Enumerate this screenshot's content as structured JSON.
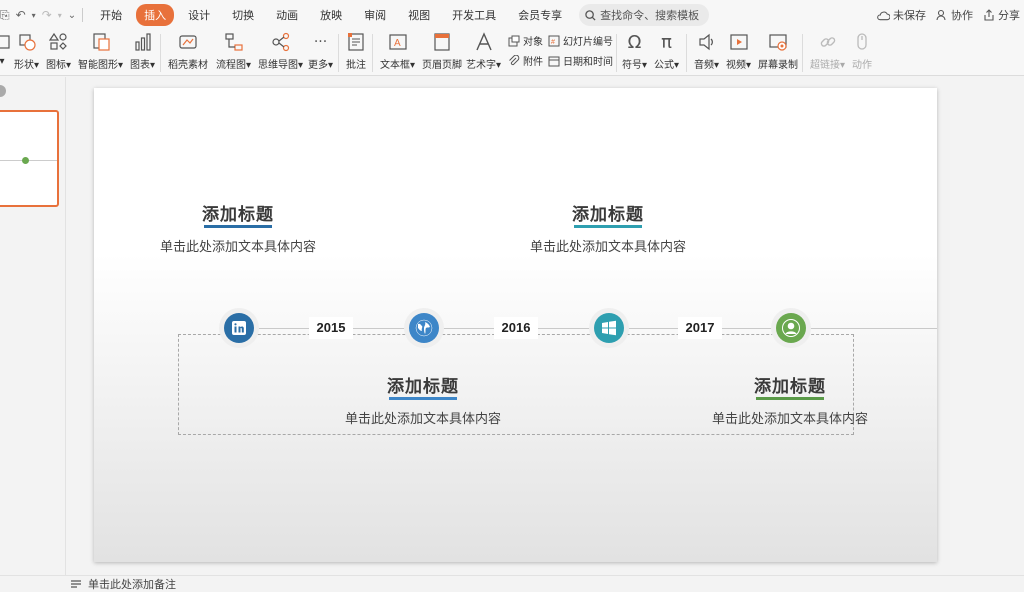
{
  "menu": {
    "tabs": [
      "开始",
      "插入",
      "设计",
      "切换",
      "动画",
      "放映",
      "审阅",
      "视图",
      "开发工具",
      "会员专享"
    ],
    "active": "插入",
    "search_placeholder": "查找命令、搜索模板"
  },
  "top_actions": {
    "unsaved": "未保存",
    "collaborate": "协作",
    "share": "分享"
  },
  "ribbon": {
    "shape": "形状",
    "icon": "图标",
    "smartart": "智能图形",
    "chart": "图表",
    "material": "稻壳素材",
    "flowchart": "流程图",
    "mindmap": "思维导图",
    "more": "更多",
    "comment": "批注",
    "textbox": "文本框",
    "header_footer": "页眉页脚",
    "wordart": "艺术字",
    "object": "对象",
    "attachment": "附件",
    "slide_number": "幻灯片编号",
    "date_time": "日期和时间",
    "symbol": "符号",
    "formula": "公式",
    "audio": "音频",
    "video": "视频",
    "screen_record": "屏幕录制",
    "hyperlink": "超链接",
    "action": "动作"
  },
  "slide": {
    "items": [
      {
        "title": "添加标题",
        "text": "单击此处添加文本具体内容",
        "accent": "#2a6ea6"
      },
      {
        "title": "添加标题",
        "text": "单击此处添加文本具体内容",
        "accent": "#2e9fb0"
      },
      {
        "title": "添加标题",
        "text": "单击此处添加文本具体内容",
        "accent": "#3d86c8"
      },
      {
        "title": "添加标题",
        "text": "单击此处添加文本具体内容",
        "accent": "#5a9a48"
      }
    ],
    "years": [
      "2015",
      "2016",
      "2017"
    ],
    "icons": [
      {
        "name": "linkedin-icon",
        "color": "#2a6ea6"
      },
      {
        "name": "globe-icon",
        "color": "#3d86c8"
      },
      {
        "name": "windows-icon",
        "color": "#2e9fb0"
      },
      {
        "name": "user-icon",
        "color": "#6aa84f"
      }
    ]
  },
  "notes_placeholder": "单击此处添加备注"
}
